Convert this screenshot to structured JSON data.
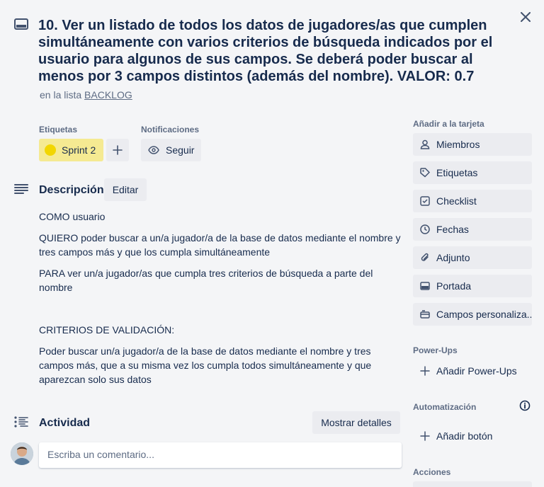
{
  "card": {
    "title": "10. Ver un listado de todos los datos de jugadores/as que cumplen simultáneamente con varios criterios de búsqueda indicados por el usuario para algunos de sus campos. Se deberá poder buscar al menos por 3 campos distintos (además del nombre). VALOR: 0.7",
    "in_list_prefix": "en la lista",
    "list_name": "BACKLOG"
  },
  "labels": {
    "heading": "Etiquetas",
    "items": [
      {
        "name": "Sprint 2",
        "color": "#f2d600",
        "bg": "#f5ea92"
      }
    ]
  },
  "notifications": {
    "heading": "Notificaciones",
    "watch_label": "Seguir"
  },
  "description": {
    "heading": "Descripción",
    "edit_label": "Editar",
    "paragraphs": [
      "COMO usuario",
      "QUIERO poder buscar a un/a jugador/a de la base de datos mediante el nombre y tres campos más y que los cumpla simultáneamente",
      "PARA ver un/a jugador/as que cumpla tres criterios de búsqueda a parte del nombre",
      "CRITERIOS DE VALIDACIÓN:",
      "Poder buscar un/a jugador/a de la base de datos mediante el nombre y tres campos más, que a su misma vez los cumpla todos simultáneamente y que aparezcan solo sus datos"
    ]
  },
  "activity": {
    "heading": "Actividad",
    "details_label": "Mostrar detalles",
    "comment_placeholder": "Escriba un comentario..."
  },
  "sidebar": {
    "add_heading": "Añadir a la tarjeta",
    "add_items": [
      {
        "label": "Miembros",
        "icon": "person-icon"
      },
      {
        "label": "Etiquetas",
        "icon": "tag-icon"
      },
      {
        "label": "Checklist",
        "icon": "checklist-icon"
      },
      {
        "label": "Fechas",
        "icon": "clock-icon"
      },
      {
        "label": "Adjunto",
        "icon": "paperclip-icon"
      },
      {
        "label": "Portada",
        "icon": "cover-icon"
      },
      {
        "label": "Campos personaliza...",
        "icon": "custom-fields-icon"
      }
    ],
    "powerups_heading": "Power-Ups",
    "add_powerups": "Añadir Power-Ups",
    "automation_heading": "Automatización",
    "add_button": "Añadir botón",
    "actions_heading": "Acciones"
  }
}
